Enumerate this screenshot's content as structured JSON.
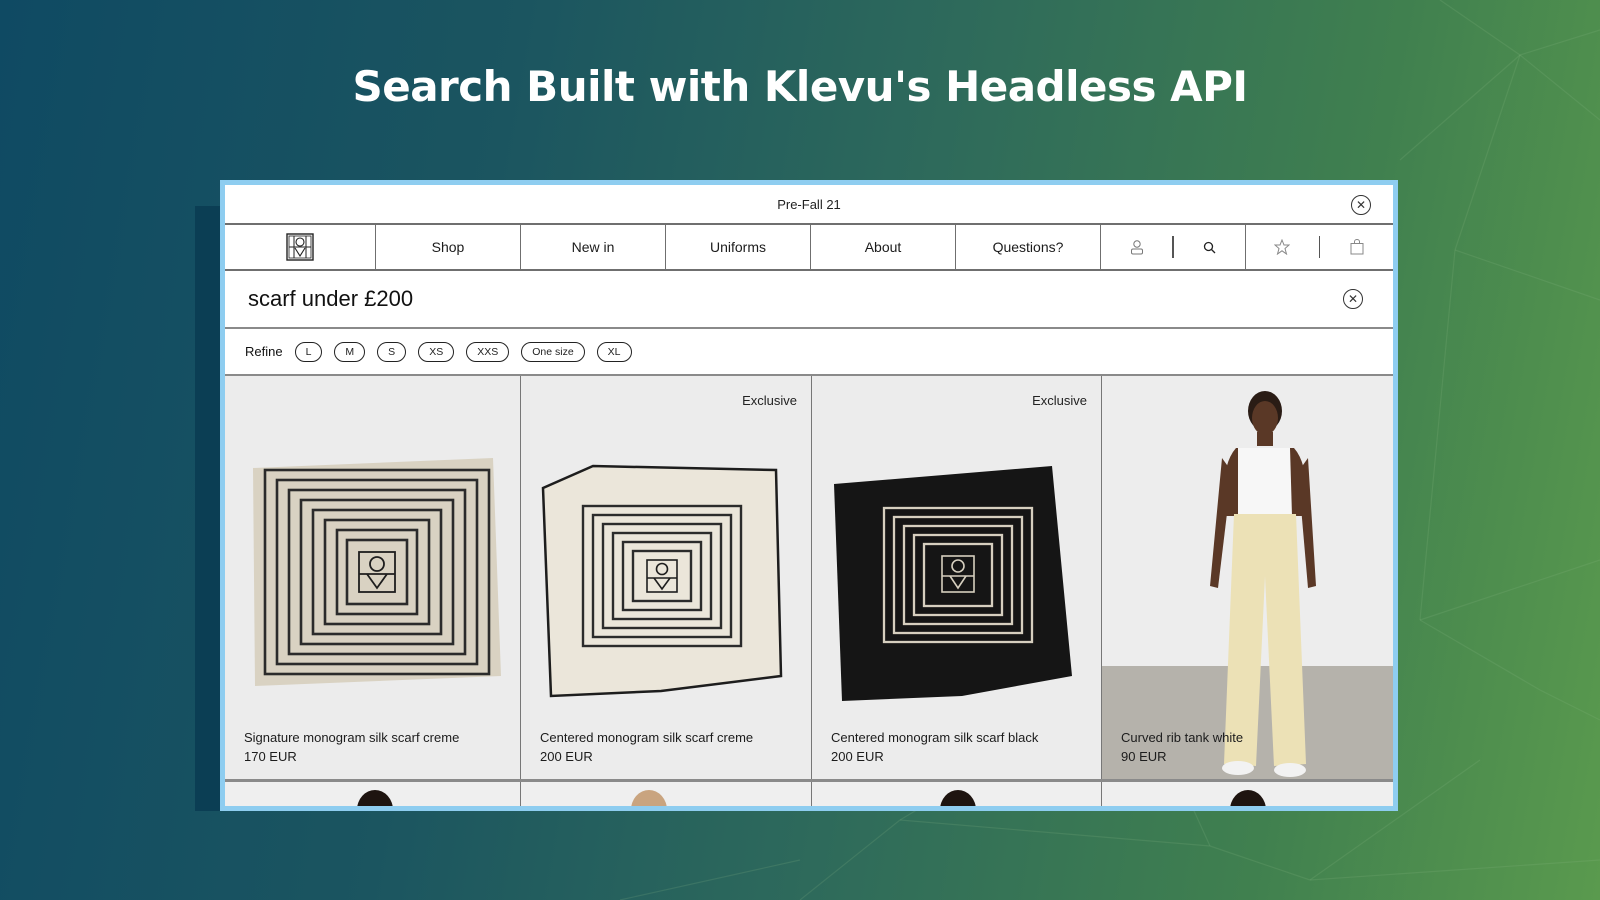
{
  "hero": {
    "title": "Search Built with Klevu's Headless API"
  },
  "colors": {
    "window_border": "#8ecdf0",
    "bg_left": "#0f4a63",
    "bg_right": "#5a9a4e"
  },
  "window": {
    "collection_label": "Pre-Fall 21",
    "close_icon": "close-circle-icon"
  },
  "nav": {
    "logo": "toteme-monogram-logo",
    "items": [
      {
        "label": "Shop"
      },
      {
        "label": "New in"
      },
      {
        "label": "Uniforms"
      },
      {
        "label": "About"
      },
      {
        "label": "Questions?"
      }
    ],
    "icons": [
      "account-icon",
      "search-icon",
      "wishlist-star-icon",
      "bag-icon"
    ]
  },
  "search": {
    "value": "scarf under £200",
    "clear_icon": "clear-circle-icon"
  },
  "refine": {
    "label": "Refine",
    "sizes": [
      "L",
      "M",
      "S",
      "XS",
      "XXS",
      "One size",
      "XL"
    ]
  },
  "products": [
    {
      "title": "Signature monogram silk scarf creme",
      "price": "170 EUR",
      "badge": ""
    },
    {
      "title": "Centered monogram silk scarf creme",
      "price": "200 EUR",
      "badge": "Exclusive"
    },
    {
      "title": "Centered monogram silk scarf black",
      "price": "200 EUR",
      "badge": "Exclusive"
    },
    {
      "title": "Curved rib tank white",
      "price": "90 EUR",
      "badge": ""
    }
  ]
}
